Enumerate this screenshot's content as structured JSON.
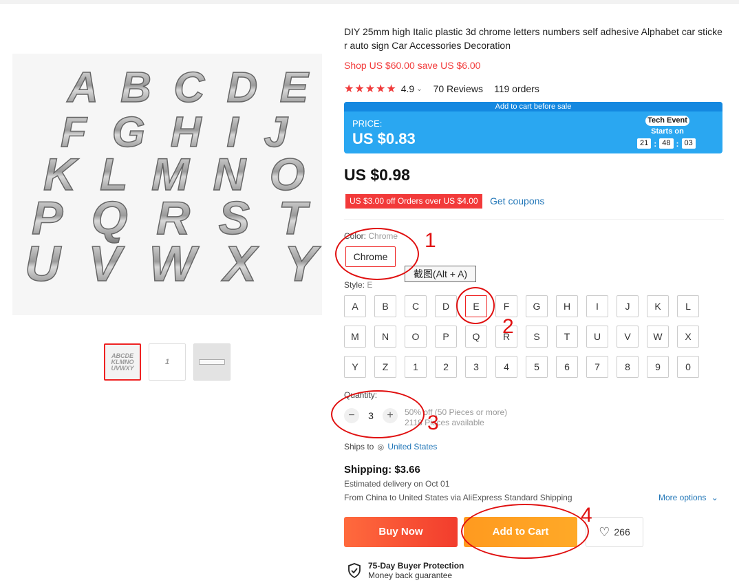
{
  "product": {
    "title": "DIY 25mm high Italic plastic 3d chrome letters numbers self adhesive Alphabet car sticker auto sign Car Accessories Decoration",
    "shop_promo": "Shop US $60.00 save US $6.00",
    "rating": "4.9",
    "reviews": "70 Reviews",
    "orders": "119 orders",
    "main_image_letters": [
      "ABCDE",
      "FGHIJ",
      "KLMNO",
      "PQRST",
      "UVWXY"
    ],
    "thumbnails": [
      "letters-thumbnail",
      "numbers-thumbnail",
      "badge-thumbnail"
    ]
  },
  "promo": {
    "banner": "Add to cart before sale",
    "label": "PRICE:",
    "price": "US $0.83",
    "event": "Tech Event",
    "starts": "Starts on",
    "timer": [
      "21",
      "48",
      "03"
    ]
  },
  "price": "US $0.98",
  "coupon": {
    "text": "US $3.00 off Orders over US $4.00",
    "link": "Get coupons"
  },
  "color": {
    "label": "Color:",
    "value": "Chrome",
    "option": "Chrome"
  },
  "tooltip": "截图(Alt + A)",
  "style": {
    "label": "Style:",
    "value": "E",
    "options": [
      "A",
      "B",
      "C",
      "D",
      "E",
      "F",
      "G",
      "H",
      "I",
      "J",
      "K",
      "L",
      "M",
      "N",
      "O",
      "P",
      "Q",
      "R",
      "S",
      "T",
      "U",
      "V",
      "W",
      "X",
      "Y",
      "Z",
      "1",
      "2",
      "3",
      "4",
      "5",
      "6",
      "7",
      "8",
      "9",
      "0"
    ],
    "selected": "E"
  },
  "quantity": {
    "label": "Quantity:",
    "value": "3",
    "discount": "50% off (50 Pieces or more)",
    "available": "2118 Pieces available"
  },
  "shipping": {
    "ships_to_label": "Ships to",
    "destination": "United States",
    "cost": "Shipping: $3.66",
    "estimate": "Estimated delivery on Oct 01",
    "route": "From China to United States via AliExpress Standard Shipping",
    "more": "More options"
  },
  "actions": {
    "buy_now": "Buy Now",
    "add_to_cart": "Add to Cart",
    "wishlist_count": "266"
  },
  "protection": {
    "title": "75-Day Buyer Protection",
    "subtitle": "Money back guarantee"
  },
  "annotations": [
    "1",
    "2",
    "3",
    "4"
  ],
  "colors": {
    "accent_red": "#f23a3a",
    "promo_blue": "#2aa7f1",
    "link_blue": "#2377b8",
    "annotation_red": "#e01010"
  }
}
